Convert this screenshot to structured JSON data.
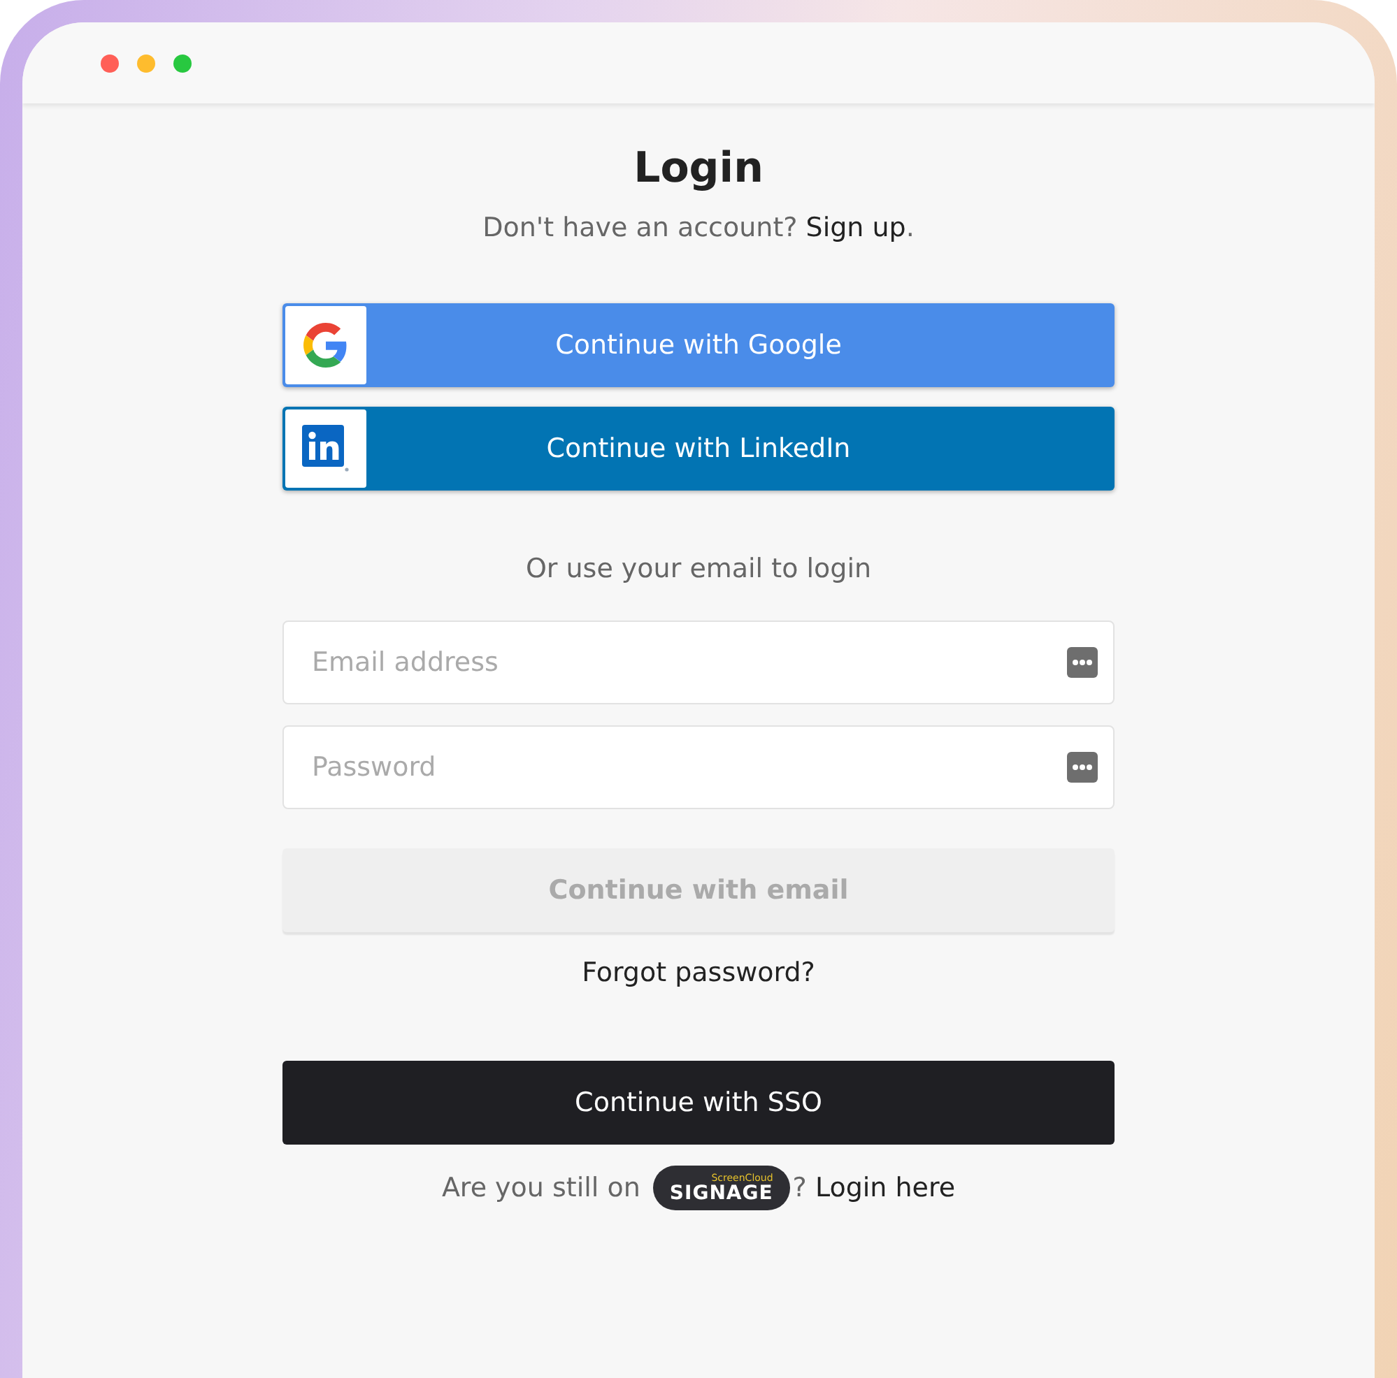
{
  "title": "Login",
  "signup_prompt": {
    "text": "Don't have an account?",
    "link": "Sign up",
    "after": "."
  },
  "social_buttons": [
    {
      "kind": "google",
      "label": "Continue with Google"
    },
    {
      "kind": "linkedin",
      "label": "Continue with LinkedIn"
    }
  ],
  "divider_text": "Or use your email to login",
  "fields": [
    {
      "placeholder": "Email address"
    },
    {
      "placeholder": "Password"
    }
  ],
  "email_button": {
    "label": "Continue with email",
    "disabled": true
  },
  "forgot_link": "Forgot password?",
  "sso_button": {
    "label": "Continue with SSO"
  },
  "legacy": {
    "text": "Are you still on",
    "logo_small": "ScreenCloud",
    "logo_big": "SIGNAGE",
    "after": "?",
    "link": "Login here"
  }
}
